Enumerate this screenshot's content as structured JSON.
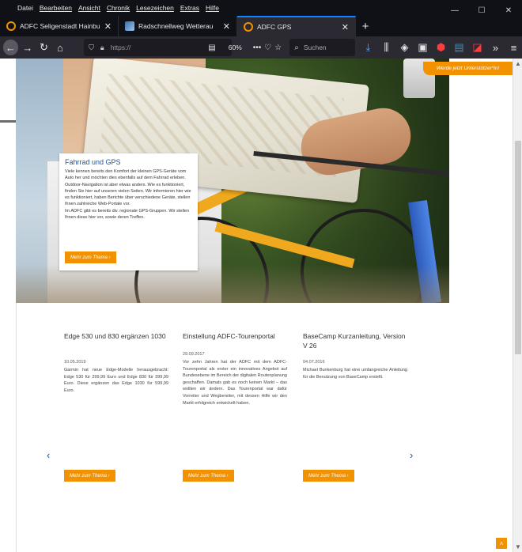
{
  "menu": {
    "items": [
      "Datei",
      "Bearbeiten",
      "Ansicht",
      "Chronik",
      "Lesezeichen",
      "Extras",
      "Hilfe"
    ],
    "underline_first": [
      false,
      true,
      true,
      true,
      true,
      true,
      true
    ]
  },
  "window": {
    "minimize": "—",
    "maximize": "☐",
    "close": "✕"
  },
  "tabs": [
    {
      "title": "ADFC Seligenstadt Hainburg | M",
      "close": "✕"
    },
    {
      "title": "Radschnellweg Wetterau",
      "close": "✕"
    },
    {
      "title": "ADFC GPS",
      "close": "✕"
    }
  ],
  "new_tab": "+",
  "nav": {
    "back": "←",
    "forward": "→",
    "reload": "↻",
    "home": "⌂",
    "url_text": "https://",
    "zoom": "60%",
    "more": "•••",
    "pocket": "♡",
    "star": "☆",
    "search_placeholder": "Suchen",
    "search_icon": "⌕",
    "download": "⤓",
    "library": "⫼",
    "overflow": "»",
    "menu": "≡"
  },
  "page": {
    "support_badge": "Werde jetzt Unterstützer*in!",
    "feature": {
      "title": "Fahrrad und GPS",
      "text": "Viele kennen bereits den Komfort der kleinen GPS-Geräte vom Auto her und möchten dies ebenfalls auf dem Fahrrad erleben. Outdoor-Navigation ist aber etwas anders. Wie es funktioniert, finden Sie hier auf unseren vielen Seiten. Wir informieren hier wie es funktioniert, haben Berichte über verschiedene Geräte, stellen Ihnen zahlreiche Web-Portale vor.",
      "text2": "Im ADFC gibt es bereits div. regionale GPS-Gruppen. Wir stellen Ihnen diese hier vor, sowie deren Treffen.",
      "button": "Mehr zum Thema  ›"
    },
    "news": [
      {
        "title": "Edge 530 und 830 ergänzen 1030",
        "date": "10.05.2019",
        "body": "Garmin hat neue Edge-Modelle herausgebracht: Edge 530 für 299,99 Euro und Edge 830 für 399,99 Euro. Diese ergänzen das Edge 1030 für 599,99 Euro.",
        "button": "Mehr zum Thema  ›"
      },
      {
        "title": "Einstellung ADFC-Tourenportal",
        "date": "29.09.2017",
        "body": "Vor zehn Jahren hat der ADFC mit dem ADFC-Tourenportal als erster ein innovatives Angebot auf Bundesebene im Bereich der digitalen Routenplanung geschaffen. Damals gab es noch keinen Markt – das wollten wir ändern. Das Tourenportal war dafür Vorreiter und Wegbereiter, mit dessen Hilfe wir den Markt erfolgreich entwickelt haben.",
        "button": "Mehr zum Thema  ›"
      },
      {
        "title": "BaseCamp Kurzanleitung, Version V 26",
        "date": "04.07.2016",
        "body": "Michael Bunkenburg hat eine umfangreiche Anleitung für die Benutzung von BaseCamp erstellt.",
        "button": "Mehr zum Thema  ›"
      }
    ],
    "prev_arrow": "‹",
    "next_arrow": "›",
    "to_top": "˄"
  },
  "colors": {
    "accent_orange": "#f39200",
    "link_blue": "#1a56a8",
    "chrome_dark": "#0f1117",
    "toolbar": "#2b2a33"
  }
}
